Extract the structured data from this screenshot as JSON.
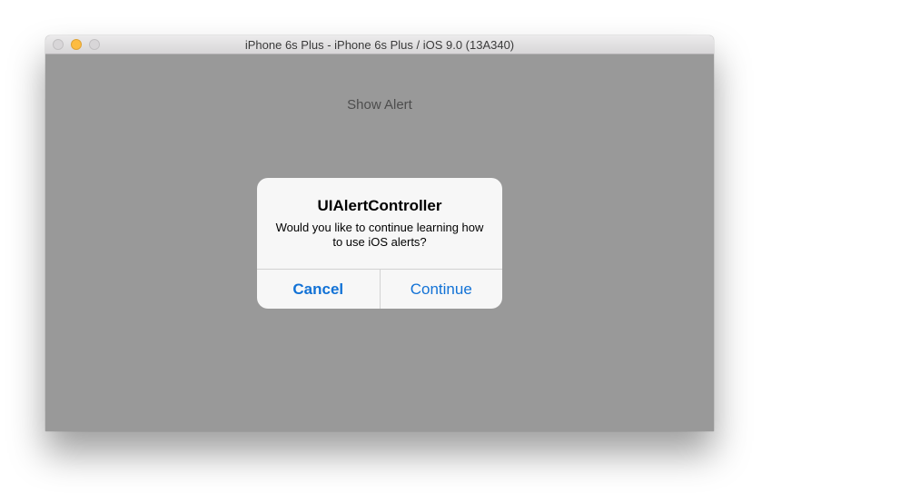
{
  "window": {
    "title": "iPhone 6s Plus - iPhone 6s Plus / iOS 9.0 (13A340)"
  },
  "screen": {
    "show_alert_label": "Show Alert"
  },
  "alert": {
    "title": "UIAlertController",
    "message": "Would you like to continue learning how to use iOS alerts?",
    "cancel_label": "Cancel",
    "continue_label": "Continue"
  },
  "colors": {
    "accent": "#1272d6",
    "screen_background": "#999999",
    "alert_background": "#f7f7f7",
    "minimize_button": "#fdbc40"
  }
}
